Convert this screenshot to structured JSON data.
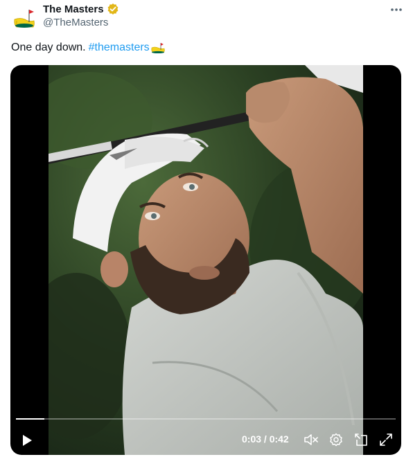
{
  "tweet": {
    "author_name": "The Masters",
    "handle": "@TheMasters",
    "text": "One day down.",
    "hashtag": "#themasters"
  },
  "video": {
    "time_display": "0:03 / 0:42",
    "progress_fraction": 0.075
  },
  "colors": {
    "link": "#1d9bf0",
    "secondary_text": "#536471",
    "verified_gold": "#e2b719",
    "masters_yellow": "#f3d21b",
    "masters_green": "#006747"
  },
  "icons": {
    "avatar": "masters-logo-icon",
    "verified": "verified-badge-icon",
    "more": "more-options-icon",
    "hashflag": "masters-hashflag-icon",
    "play": "play-icon",
    "mute": "mute-icon",
    "settings": "settings-gear-icon",
    "pip": "picture-in-picture-icon",
    "fullscreen": "fullscreen-icon"
  }
}
